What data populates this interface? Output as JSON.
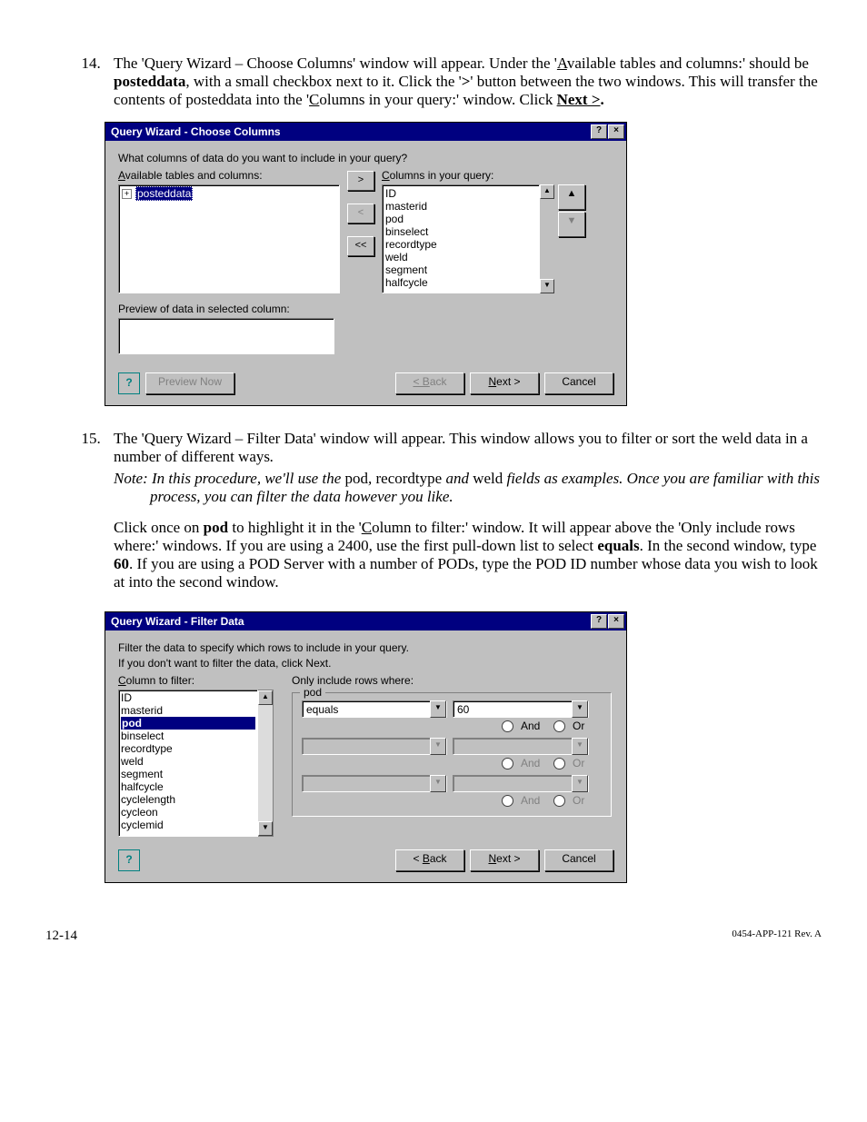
{
  "step14": {
    "number": "14.",
    "text_a": "The 'Query Wizard – Choose Columns' window will appear. Under the '",
    "link_available": "A",
    "text_a2": "vailable tables and columns:' should be ",
    "bold_posteddata": "posteddata",
    "text_b": ", with a small checkbox next to it. Click the '",
    "bold_gt": ">",
    "text_c": "' button between the two windows. This will transfer the contents of posteddata into the '",
    "link_columns": "C",
    "text_c2": "olumns in your query:' window. Click ",
    "bold_next": "Next >",
    "text_d": "."
  },
  "dialog1": {
    "title": "Query Wizard - Choose Columns",
    "help": "?",
    "close": "×",
    "prompt": "What columns of data do you want to include in your query?",
    "available_label_u": "A",
    "available_label": "vailable tables and columns:",
    "columns_label_u": "C",
    "columns_label": "olumns in your query:",
    "tree_item": "posteddata",
    "move_add": ">",
    "move_remove": "<",
    "move_remove_all": "<<",
    "query_columns": [
      "ID",
      "masterid",
      "pod",
      "binselect",
      "recordtype",
      "weld",
      "segment",
      "halfcycle"
    ],
    "preview_label": "Preview of data in selected column:",
    "btn_preview": "Preview Now",
    "btn_back": "< Back",
    "btn_next_u": "N",
    "btn_next": "ext >",
    "btn_cancel": "Cancel"
  },
  "step15": {
    "number": "15.",
    "text_a": "The 'Query Wizard – Filter Data' window will appear. This window allows you to filter or sort the weld data in a number of different ways",
    "period": ".",
    "note_label": "Note: In this procedure, we'll use the ",
    "note_pod": "pod",
    "note_comma": ", ",
    "note_recordtype": "recordtype",
    "note_and": " and ",
    "note_weld": "weld",
    "note_rest": " fields as examples.  Once you are familiar with this process, you can filter the data however you like.",
    "para2_a": "Click once on ",
    "para2_pod": "pod",
    "para2_b": " to highlight it in the '",
    "para2_col_u": "C",
    "para2_b2": "olumn to filter:' window. It will appear above the 'Only include rows where:' windows. If you are using a 2400, use the first pull-down list to select ",
    "para2_equals": "equals",
    "para2_c": ". In the second window, type ",
    "para2_60": "60",
    "para2_d": ". If you are using a POD Server with a number of PODs, type the POD ID number whose data you wish to look at into the second window."
  },
  "dialog2": {
    "title": "Query Wizard - Filter Data",
    "help": "?",
    "close": "×",
    "prompt1": "Filter the data to specify which rows to include in your query.",
    "prompt2": "If you don't want to filter the data, click Next.",
    "column_label_u": "C",
    "column_label": "olumn to filter:",
    "only_label": "Only include rows where:",
    "group_title": "pod",
    "filter_items": [
      "ID",
      "masterid",
      "pod",
      "binselect",
      "recordtype",
      "weld",
      "segment",
      "halfcycle",
      "cyclelength",
      "cycleon",
      "cyclemid"
    ],
    "selected_index": 2,
    "cond1_op": "equals",
    "cond1_val": "60",
    "and": "And",
    "or": "Or",
    "btn_back_u": "B",
    "btn_back": "ack",
    "btn_next_u": "N",
    "btn_next": "ext >",
    "btn_cancel": "Cancel"
  },
  "footer": {
    "page": "12-14",
    "rev": "0454-APP-121 Rev. A"
  }
}
